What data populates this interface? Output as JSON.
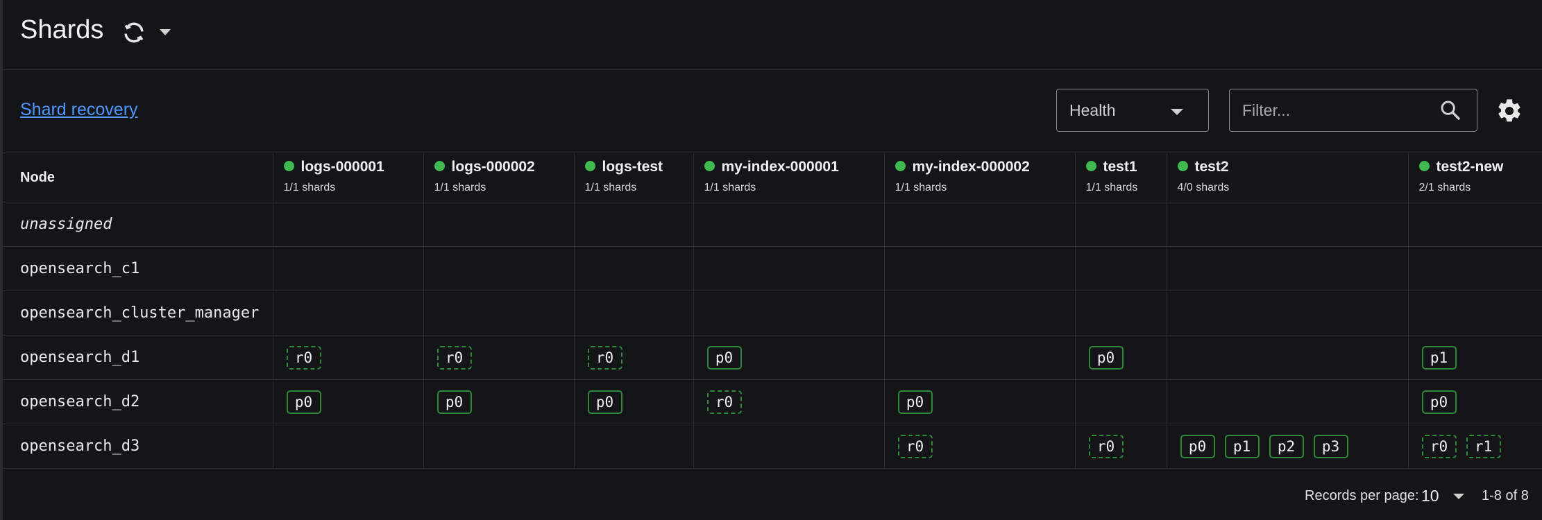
{
  "header": {
    "title": "Shards"
  },
  "toolbar": {
    "recovery_link": "Shard recovery",
    "health_select": "Health",
    "filter_placeholder": "Filter..."
  },
  "table": {
    "node_header": "Node",
    "indices": [
      {
        "name": "logs-000001",
        "shards": "1/1 shards"
      },
      {
        "name": "logs-000002",
        "shards": "1/1 shards"
      },
      {
        "name": "logs-test",
        "shards": "1/1 shards"
      },
      {
        "name": "my-index-000001",
        "shards": "1/1 shards"
      },
      {
        "name": "my-index-000002",
        "shards": "1/1 shards"
      },
      {
        "name": "test1",
        "shards": "1/1 shards"
      },
      {
        "name": "test2",
        "shards": "4/0 shards"
      },
      {
        "name": "test2-new",
        "shards": "2/1 shards"
      }
    ],
    "rows": [
      {
        "node": "unassigned",
        "cells": [
          [],
          [],
          [],
          [],
          [],
          [],
          [],
          []
        ]
      },
      {
        "node": "opensearch_c1",
        "cells": [
          [],
          [],
          [],
          [],
          [],
          [],
          [],
          []
        ]
      },
      {
        "node": "opensearch_cluster_manager",
        "cells": [
          [],
          [],
          [],
          [],
          [],
          [],
          [],
          []
        ]
      },
      {
        "node": "opensearch_d1",
        "cells": [
          [
            "r0"
          ],
          [
            "r0"
          ],
          [
            "r0"
          ],
          [
            "p0"
          ],
          [],
          [
            "p0"
          ],
          [],
          [
            "p1"
          ]
        ]
      },
      {
        "node": "opensearch_d2",
        "cells": [
          [
            "p0"
          ],
          [
            "p0"
          ],
          [
            "p0"
          ],
          [
            "r0"
          ],
          [
            "p0"
          ],
          [],
          [],
          [
            "p0"
          ]
        ]
      },
      {
        "node": "opensearch_d3",
        "cells": [
          [],
          [],
          [],
          [],
          [
            "r0"
          ],
          [
            "r0"
          ],
          [
            "p0",
            "p1",
            "p2",
            "p3"
          ],
          [
            "r0",
            "r1"
          ]
        ]
      }
    ]
  },
  "pagination": {
    "records_label": "Records per page:",
    "records_value": "10",
    "range": "1-8 of 8"
  },
  "colors": {
    "background": "#141519",
    "health_green": "#3fb950",
    "shard_border": "#2f8a3a",
    "link": "#4d97ff"
  },
  "icons": {
    "refresh": "refresh-icon",
    "search": "search-icon",
    "settings": "gear-icon"
  }
}
